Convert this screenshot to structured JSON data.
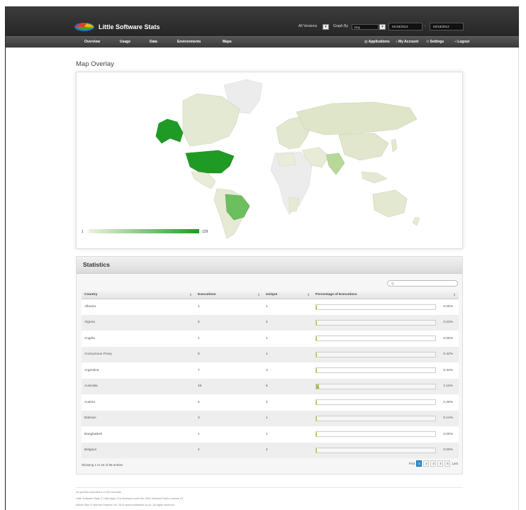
{
  "app": {
    "name": "Little Software Stats",
    "colors": {
      "topbar": "#2e2e2e",
      "accent": "#1f9b25",
      "bar_fill": "#a3c240",
      "pager_active": "#2f8fd0"
    }
  },
  "header": {
    "versions_label": "All Versions",
    "graph_by_label": "Graph By",
    "graph_by_value": "Day",
    "date_from": "01/18/2013",
    "date_to": "02/18/2013",
    "date_separator": "-"
  },
  "nav": {
    "left": [
      "Overview",
      "Usage",
      "Data",
      "Environments",
      "Maps"
    ],
    "right": [
      "Applications",
      "My Account",
      "Settings",
      "Logout"
    ]
  },
  "map": {
    "title": "Map Overlay",
    "legend_min": "1",
    "legend_max": "129"
  },
  "stats": {
    "title": "Statistics",
    "search_placeholder": "Q",
    "columns": [
      "Country",
      "Executions",
      "Unique",
      "Percentage of Executions"
    ],
    "rows": [
      {
        "country": "Albania",
        "executions": "1",
        "unique": "1",
        "pct": "0.05%",
        "fill": 0.0005
      },
      {
        "country": "Algeria",
        "executions": "5",
        "unique": "2",
        "pct": "0.23%",
        "fill": 0.0023
      },
      {
        "country": "Angola",
        "executions": "1",
        "unique": "1",
        "pct": "0.05%",
        "fill": 0.0005
      },
      {
        "country": "Anonymous Proxy",
        "executions": "9",
        "unique": "1",
        "pct": "0.42%",
        "fill": 0.0042
      },
      {
        "country": "Argentina",
        "executions": "7",
        "unique": "3",
        "pct": "0.33%",
        "fill": 0.0033
      },
      {
        "country": "Australia",
        "executions": "46",
        "unique": "6",
        "pct": "2.16%",
        "fill": 0.0216
      },
      {
        "country": "Austria",
        "executions": "6",
        "unique": "4",
        "pct": "0.28%",
        "fill": 0.0028
      },
      {
        "country": "Bahrain",
        "executions": "3",
        "unique": "1",
        "pct": "0.14%",
        "fill": 0.0014
      },
      {
        "country": "Bangladesh",
        "executions": "1",
        "unique": "1",
        "pct": "0.05%",
        "fill": 0.0005
      },
      {
        "country": "Belgium",
        "executions": "2",
        "unique": "2",
        "pct": "0.09%",
        "fill": 0.0009
      }
    ],
    "showing": "Showing 1 to 10 of 68 entries",
    "pager": {
      "first": "First",
      "pages": [
        "1",
        "2",
        "3",
        "4",
        "5"
      ],
      "last": "Last",
      "current": "1"
    }
  },
  "footer": {
    "line1": "43 queries executed in 0.253 seconds",
    "line2": "Little Software Stats © Little Apps. It is licensed under the GNU General Public License v3.",
    "line3": "Admin Skin © Internet Dreams Ltd. 2013 www.netdreams.co.uk. All rights reserved."
  }
}
